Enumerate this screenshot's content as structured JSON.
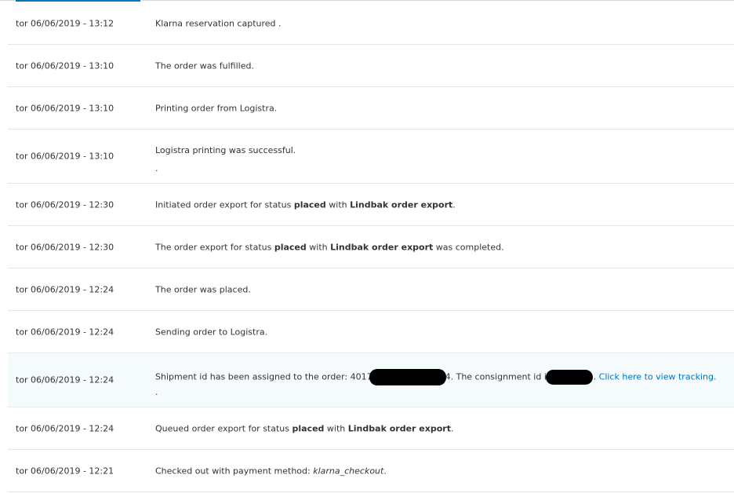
{
  "log": [
    {
      "date": "tor 06/06/2019 - 13:12",
      "text": "Klarna reservation captured ."
    },
    {
      "date": "tor 06/06/2019 - 13:10",
      "text": "The order was fulfilled."
    },
    {
      "date": "tor 06/06/2019 - 13:10",
      "text": "Printing order from Logistra."
    },
    {
      "date": "tor 06/06/2019 - 13:10",
      "text": "Logistra printing was successful.",
      "dot": "."
    },
    {
      "date": "tor 06/06/2019 - 12:30",
      "pre": "Initiated order export for status ",
      "b1": "placed",
      "mid": " with ",
      "b2": "Lindbak order export",
      "post": "."
    },
    {
      "date": "tor 06/06/2019 - 12:30",
      "pre": "The order export for status ",
      "b1": "placed",
      "mid": " with ",
      "b2": "Lindbak order export",
      "post": " was completed."
    },
    {
      "date": "tor 06/06/2019 - 12:24",
      "text": "The order was placed."
    },
    {
      "date": "tor 06/06/2019 - 12:24",
      "text": "Sending order to Logistra."
    },
    {
      "date": "tor 06/06/2019 - 12:24",
      "pre": "Shipment id has been assigned to the order: 4017",
      "mid": "4. The consignment id is",
      "post": ".",
      "link": "Click here to view tracking.",
      "dot": "."
    },
    {
      "date": "tor 06/06/2019 - 12:24",
      "pre": "Queued order export for status ",
      "b1": "placed",
      "mid": " with ",
      "b2": "Lindbak order export",
      "post": "."
    },
    {
      "date": "tor 06/06/2019 - 12:21",
      "pre": "Checked out with payment method: ",
      "em": "klarna_checkout",
      "post": "."
    }
  ],
  "colors": {
    "link": "#0074bd",
    "highlight_row": "#f5fafd",
    "tab_underline": "#0074bd"
  }
}
